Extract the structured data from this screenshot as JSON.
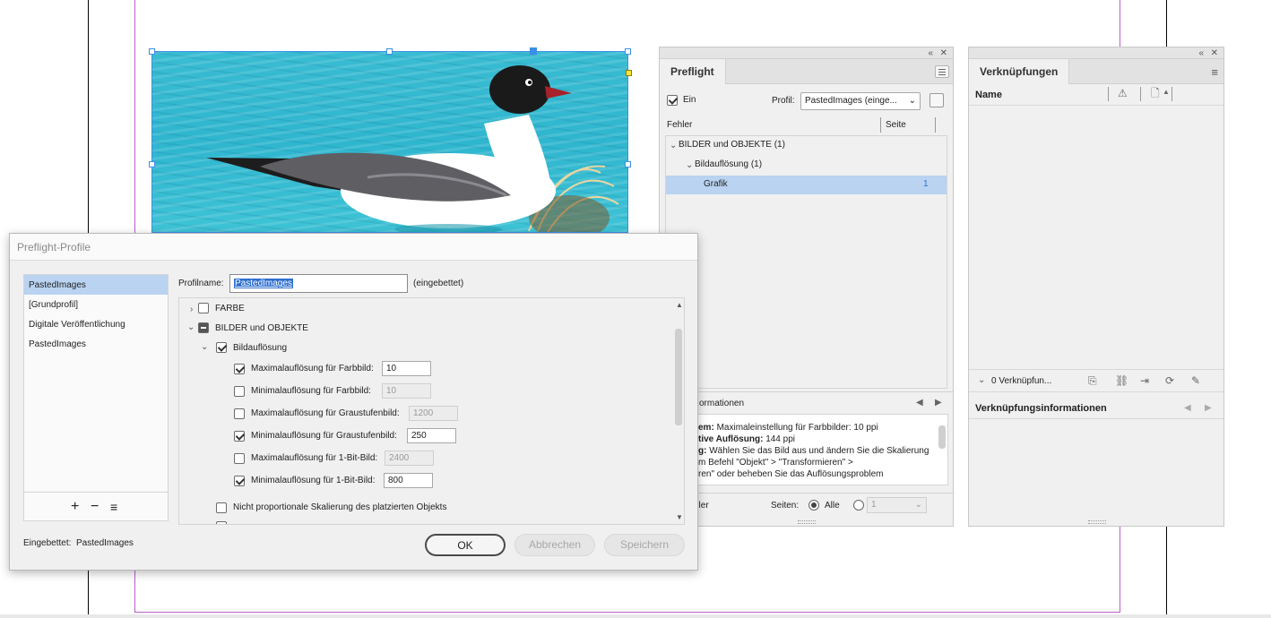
{
  "colors": {
    "guide_magenta": "#b85fc7",
    "selection_blue": "#3b8fe8",
    "row_highlight": "#b9d3f1",
    "water": "#33b8d0"
  },
  "preflight_panel": {
    "tab": "Preflight",
    "on_label": "Ein",
    "profile_label": "Profil:",
    "profile_value": "PastedImages (einge...",
    "errors_header": "Fehler",
    "page_header": "Seite",
    "tree": [
      {
        "label": "BILDER und OBJEKTE (1)"
      },
      {
        "label": "Bildauflösung (1)"
      },
      {
        "label": "Grafik",
        "page": "1"
      }
    ],
    "info_title": "ormationen",
    "info_lines": [
      {
        "key": "em:",
        "value": "Maximaleinstellung für Farbbilder: 10 ppi"
      },
      {
        "key": "tive Auflösung:",
        "value": "144 ppi"
      },
      {
        "key": "g:",
        "value": "Wählen Sie das Bild aus und ändern Sie die Skalierung"
      },
      {
        "key": "",
        "value": "m Befehl \"Objekt\" > \"Transformieren\" >"
      },
      {
        "key": "",
        "value": "ren\" oder beheben Sie das Auflösungsproblem"
      }
    ],
    "footer_errors": "hler",
    "pages_label": "Seiten:",
    "all_label": "Alle",
    "page_select": "1"
  },
  "links_panel": {
    "tab": "Verknüpfungen",
    "name_header": "Name",
    "count_label": "0 Verknüpfun...",
    "info_title": "Verknüpfungsinformationen"
  },
  "dialog": {
    "title": "Preflight-Profile",
    "profiles": [
      "PastedImages",
      "[Grundprofil]",
      "Digitale Veröffentlichung",
      "PastedImages"
    ],
    "profile_name_label": "Profilname:",
    "profile_name_value": "PastedImages",
    "embedded_note": "(eingebettet)",
    "categories": {
      "color": "FARBE",
      "images": "BILDER und OBJEKTE",
      "resolution": "Bildauflösung"
    },
    "rules": [
      {
        "label": "Maximalauflösung für Farbbild:",
        "value": "10",
        "checked": true
      },
      {
        "label": "Minimalauflösung für Farbbild:",
        "value": "10",
        "checked": false
      },
      {
        "label": "Maximalauflösung für Graustufenbild:",
        "value": "1200",
        "checked": false
      },
      {
        "label": "Minimalauflösung für Graustufenbild:",
        "value": "250",
        "checked": true
      },
      {
        "label": "Maximalauflösung für 1-Bit-Bild:",
        "value": "2400",
        "checked": false
      },
      {
        "label": "Minimalauflösung für 1-Bit-Bild:",
        "value": "800",
        "checked": true
      }
    ],
    "nonprop_label": "Nicht proportionale Skalierung des platzierten Objekts",
    "add_symbol": "+",
    "remove_symbol": "−",
    "menu_symbol": "≡",
    "embedded_status_label": "Eingebettet:",
    "embedded_status_value": "PastedImages",
    "ok": "OK",
    "cancel": "Abbrechen",
    "save": "Speichern"
  }
}
